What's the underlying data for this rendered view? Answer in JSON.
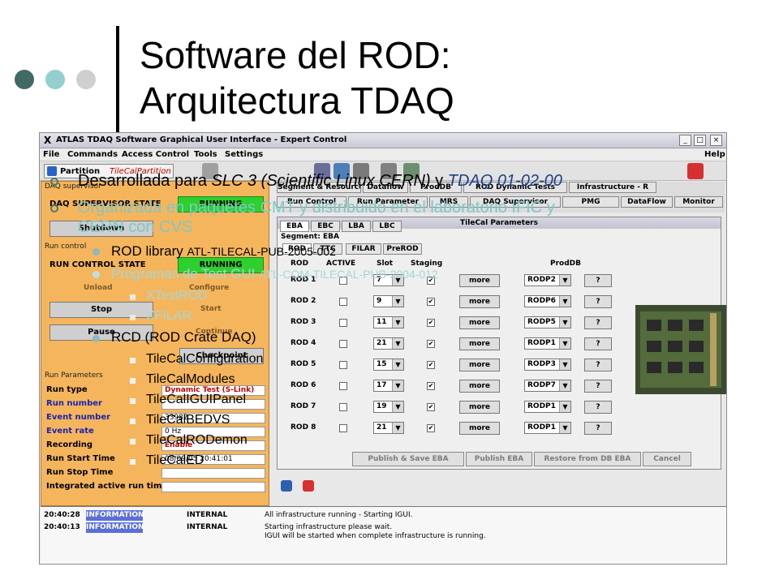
{
  "slide": {
    "title_line1": "Software del ROD:",
    "title_line2": "Arquitectura TDAQ",
    "dot_colors": [
      "#3f6b64",
      "#93cfd0",
      "#cfcfcf"
    ]
  },
  "window": {
    "title": "ATLAS TDAQ Software Graphical User Interface - Expert Control",
    "menus": [
      "File",
      "Commands",
      "Access Control",
      "Tools",
      "Settings"
    ],
    "help_menu": "Help",
    "partition_label": "Partition",
    "partition_value": "TileCalPartition"
  },
  "daq_panel": {
    "section_label": "DAQ supervisor",
    "supervisor_state_label": "DAQ SUPERVISOR STATE",
    "supervisor_state_value": "RUNNING",
    "shutdown_button": "Shutdown",
    "run_control_label": "Run control",
    "run_control_state_label": "RUN CONTROL STATE",
    "run_control_state_value": "RUNNING",
    "unload_label": "Unload",
    "configure_label": "Configure",
    "stop_button": "Stop",
    "start_label": "Start",
    "pause_button": "Pause",
    "continue_label": "Continue",
    "checkpoint_button": "Checkpoint",
    "run_params_label": "Run Parameters",
    "params": [
      {
        "label": "Run type",
        "value": "Dynamic Test (S-Link)"
      },
      {
        "label": "Run number",
        "value": ""
      },
      {
        "label": "Event number",
        "value": "33982"
      },
      {
        "label": "Event rate",
        "value": "0 Hz"
      },
      {
        "label": "Recording",
        "value": "Enable"
      },
      {
        "label": "Run Start Time",
        "value": "08/09/05 20:41:01"
      },
      {
        "label": "Run Stop Time",
        "value": ""
      },
      {
        "label": "Integrated active run time",
        "value": ""
      }
    ]
  },
  "right_tabs": {
    "row1": [
      "Segment & Resource",
      "Dataflow",
      "ProdDB",
      "ROD Dynamic Tests",
      "Infrastructure - R"
    ],
    "row2": [
      "Run Control",
      "Run Parameter",
      "MRS",
      "DAQ Supervisor",
      "PMG",
      "DataFlow",
      "Monitor"
    ]
  },
  "tilecal": {
    "title": "TileCal Parameters",
    "segment_tabs": [
      "EBA",
      "EBC",
      "LBA",
      "LBC"
    ],
    "segment_label": "Segment: EBA",
    "sub_tabs": [
      "ROD",
      "TTC",
      "FILAR",
      "PreROD"
    ],
    "headers": {
      "rod": "ROD",
      "active": "ACTIVE",
      "slot": "Slot",
      "staging": "Staging",
      "proddb": "ProdDB"
    },
    "more_label": "more",
    "q_label": "?",
    "rows": [
      {
        "rod": "ROD 1",
        "slot": "7",
        "proddb": "RODP2"
      },
      {
        "rod": "ROD 2",
        "slot": "9",
        "proddb": "RODP6"
      },
      {
        "rod": "ROD 3",
        "slot": "11",
        "proddb": "RODP5"
      },
      {
        "rod": "ROD 4",
        "slot": "21",
        "proddb": "RODP1"
      },
      {
        "rod": "ROD 5",
        "slot": "15",
        "proddb": "RODP3"
      },
      {
        "rod": "ROD 6",
        "slot": "17",
        "proddb": "RODP7"
      },
      {
        "rod": "ROD 7",
        "slot": "19",
        "proddb": "RODP1"
      },
      {
        "rod": "ROD 8",
        "slot": "21",
        "proddb": "RODP1"
      }
    ],
    "buttons": [
      "Publish & Save EBA",
      "Publish EBA",
      "Restore from DB EBA",
      "Cancel"
    ]
  },
  "log": [
    {
      "time": "20:40:28",
      "type": "INFORMATION",
      "source": "INTERNAL",
      "message": "All infrastructure running - Starting IGUI."
    },
    {
      "time": "20:40:13",
      "type": "INFORMATION",
      "source": "INTERNAL",
      "message": "Starting infrastructure please wait."
    },
    {
      "time": "",
      "type": "",
      "source": "",
      "message": "IGUI will be started when complete infrastructure is running."
    }
  ],
  "bullets": {
    "b1_prefix": "Desarrollada para ",
    "b1_em1": "SLC 3 (Scientific Linux CERN)",
    "b1_mid": " y ",
    "b1_em2": "TDAQ 01-02-00",
    "b2_line1": "Organizada en paquetes CMT y distribuido en el laboratorio IFIC y",
    "b2_line2": "CERN con CVS",
    "s1_main": "ROD library",
    "s1_ref": "ATL-TILECAL-PUB-2005-002",
    "s2_main": "Programas de Test GUI",
    "s2_ref": "ATL-COM-TILECAL-PUB-2004-012",
    "s2_items": [
      "XTestROD",
      "XFILAR"
    ],
    "s3_main": "RCD (ROD Crate DAQ)",
    "s3_items": [
      "TileCalConfiguration",
      "TileCalModules",
      "TileCalIGUIPanel",
      "TileCalBEDVS",
      "TileCalRODemon",
      "TileCalED"
    ]
  }
}
